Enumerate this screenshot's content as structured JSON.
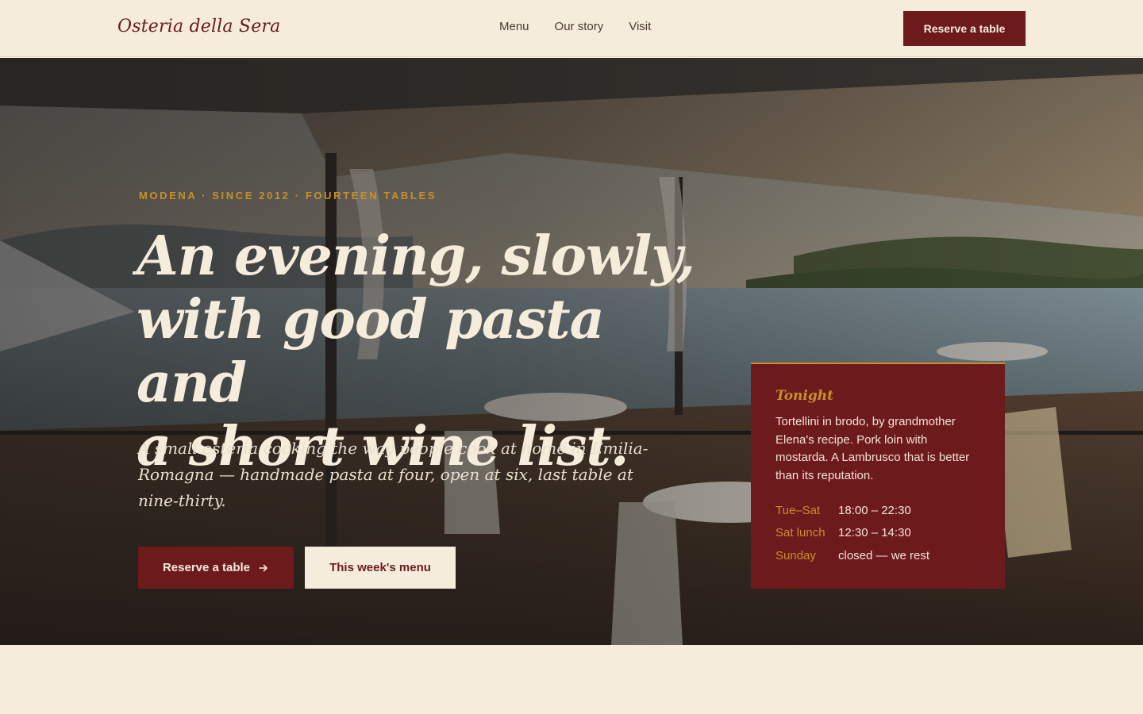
{
  "nav": {
    "brand": "Osteria della Sera",
    "links": [
      "Menu",
      "Our story",
      "Visit"
    ],
    "cta": "Reserve a table"
  },
  "hero": {
    "eyebrow": "MODENA · SINCE 2012 · FOURTEEN TABLES",
    "headline_lines": [
      "An evening, slowly,",
      "with good pasta and",
      "a short wine list."
    ],
    "lede": "A small osteria cooking the way people cook at home in Emilia-Romagna — handmade pasta at four, open at six, last table at nine-thirty.",
    "primary_button": "Reserve a table",
    "primary_button_icon": "arrow-right-icon",
    "secondary_button": "This week's menu",
    "background_image": "restaurant-terrace-photo"
  },
  "tonight": {
    "title": "Tonight",
    "body": "Tortellini in brodo, by grandmother Elena's recipe. Pork loin with mostarda. A Lambrusco that is better than its reputation.",
    "hours": [
      {
        "day": "Tue–Sat",
        "time": "18:00 – 22:30"
      },
      {
        "day": "Sat lunch",
        "time": "12:30 – 14:30"
      },
      {
        "day": "Sunday",
        "time": "closed — we rest"
      }
    ]
  },
  "colors": {
    "cream": "#f6ecdc",
    "wine": "#6d1a1c",
    "ochre": "#c8902c",
    "ink": "#3a2a22"
  }
}
